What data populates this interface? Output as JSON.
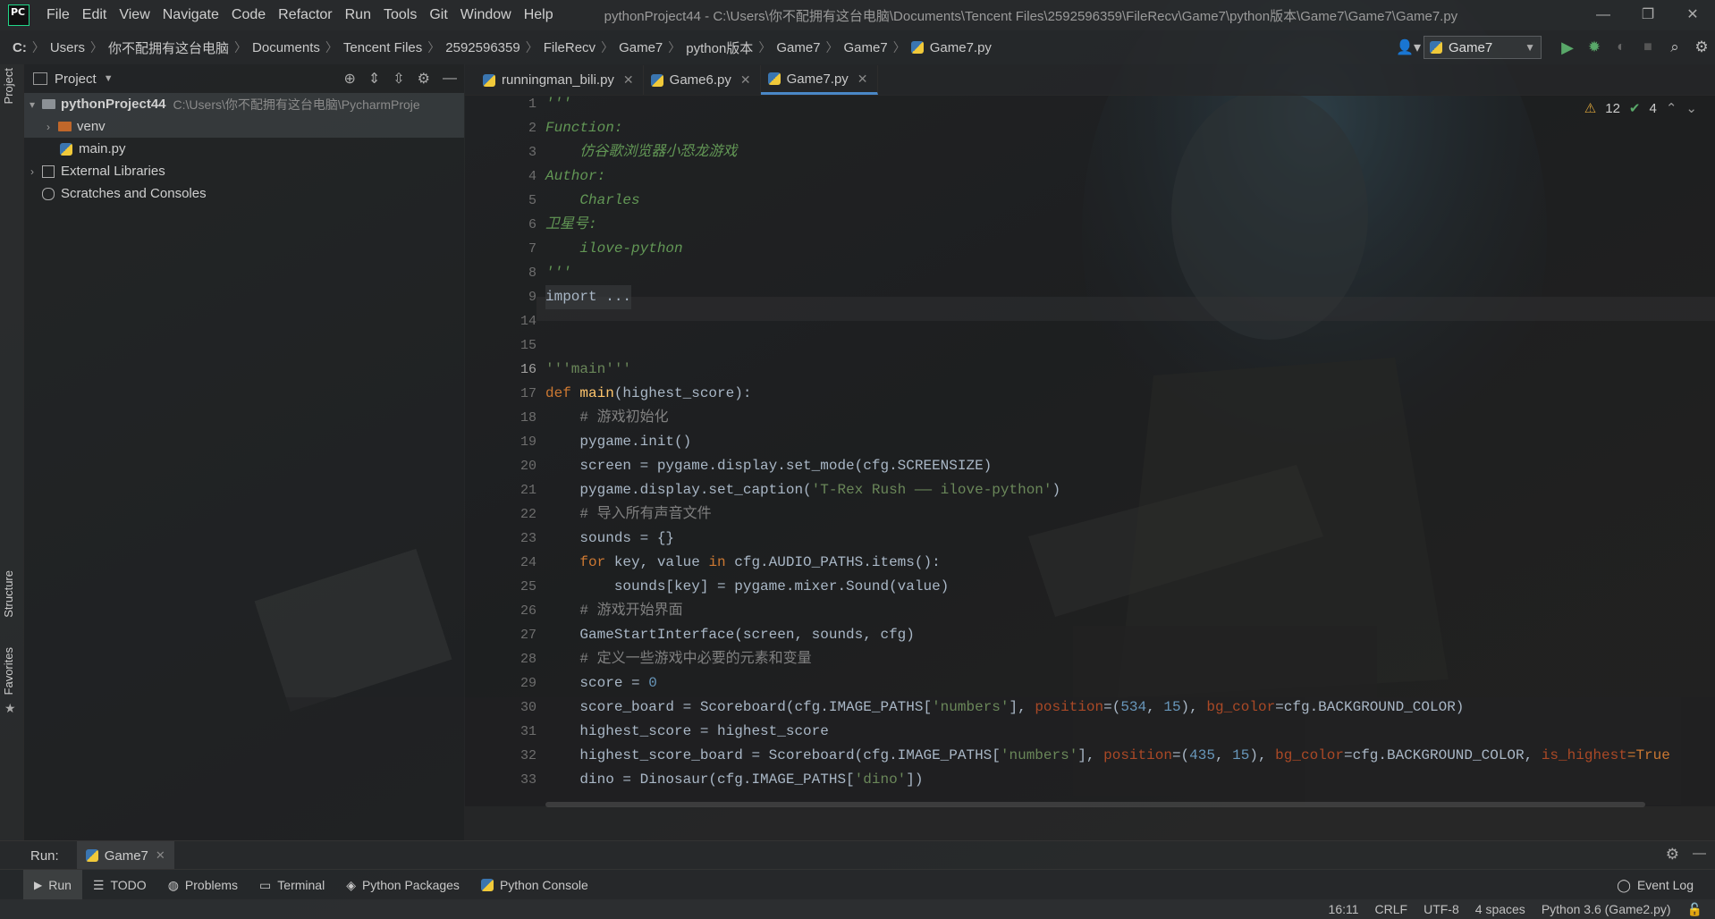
{
  "window": {
    "app_logo_text": "PC",
    "title": "pythonProject44 - C:\\Users\\你不配拥有这台电脑\\Documents\\Tencent Files\\2592596359\\FileRecv\\Game7\\python版本\\Game7\\Game7\\Game7.py",
    "controls": [
      "—",
      "❐",
      "✕"
    ]
  },
  "menu": [
    "File",
    "Edit",
    "View",
    "Navigate",
    "Code",
    "Refactor",
    "Run",
    "Tools",
    "Git",
    "Window",
    "Help"
  ],
  "breadcrumb": [
    "C:",
    "Users",
    "你不配拥有这台电脑",
    "Documents",
    "Tencent Files",
    "2592596359",
    "FileRecv",
    "Game7",
    "python版本",
    "Game7",
    "Game7",
    "Game7.py"
  ],
  "run_config": {
    "label": "Game7"
  },
  "left_tools": {
    "project": "Project",
    "structure": "Structure",
    "favorites": "Favorites"
  },
  "project_panel": {
    "title": "Project",
    "tree": [
      {
        "label": "pythonProject44",
        "path": "C:\\Users\\你不配拥有这台电脑\\PycharmProje",
        "type": "folder-root"
      },
      {
        "label": "venv",
        "type": "folder"
      },
      {
        "label": "main.py",
        "type": "file"
      },
      {
        "label": "External Libraries",
        "type": "library"
      },
      {
        "label": "Scratches and Consoles",
        "type": "scratch"
      }
    ]
  },
  "editor_tabs": [
    {
      "label": "runningman_bili.py"
    },
    {
      "label": "Game6.py"
    },
    {
      "label": "Game7.py"
    }
  ],
  "inspections": {
    "warnings": "12",
    "ok": "4"
  },
  "code": {
    "line_numbers": [
      "1",
      "2",
      "3",
      "4",
      "5",
      "6",
      "7",
      "8",
      "9",
      "14",
      "15",
      "16",
      "17",
      "18",
      "19",
      "20",
      "21",
      "22",
      "23",
      "24",
      "25",
      "26",
      "27",
      "28",
      "29",
      "30",
      "31",
      "32",
      "33"
    ],
    "l1": "'''",
    "l2": "Function:",
    "l3": "    仿谷歌浏览器小恐龙游戏",
    "l4": "Author:",
    "l5": "    Charles",
    "l6": "卫星号:",
    "l7": "    ilove-python",
    "l8": "'''",
    "l9": "import ...",
    "l16": "'''main'''",
    "l17_kw": "def ",
    "l17_fn": "main",
    "l17_rest": "(highest_score):",
    "l18": "    # 游戏初始化",
    "l19": "    pygame.init()",
    "l20": "    screen = pygame.display.set_mode(cfg.SCREENSIZE)",
    "l21_a": "    pygame.display.set_caption(",
    "l21_s": "'T-Rex Rush —— ilove-python'",
    "l21_b": ")",
    "l22": "    # 导入所有声音文件",
    "l23": "    sounds = {}",
    "l24_kw1": "    for",
    "l24_a": " key, value ",
    "l24_kw2": "in",
    "l24_b": " cfg.AUDIO_PATHS.items():",
    "l25": "        sounds[key] = pygame.mixer.Sound(value)",
    "l26": "    # 游戏开始界面",
    "l27": "    GameStartInterface(screen, sounds, cfg)",
    "l28": "    # 定义一些游戏中必要的元素和变量",
    "l29_a": "    score = ",
    "l29_n": "0",
    "l30_a": "    score_board = Scoreboard(cfg.IMAGE_PATHS[",
    "l30_s": "'numbers'",
    "l30_b": "], ",
    "l30_p1": "position",
    "l30_c": "=(",
    "l30_n1": "534",
    "l30_d": ", ",
    "l30_n2": "15",
    "l30_e": "), ",
    "l30_p2": "bg_color",
    "l30_f": "=cfg.BACKGROUND_COLOR)",
    "l31": "    highest_score = highest_score",
    "l32_a": "    highest_score_board = Scoreboard(cfg.IMAGE_PATHS[",
    "l32_s": "'numbers'",
    "l32_b": "], ",
    "l32_p1": "position",
    "l32_c": "=(",
    "l32_n1": "435",
    "l32_d": ", ",
    "l32_n2": "15",
    "l32_e": "), ",
    "l32_p2": "bg_color",
    "l32_f": "=cfg.BACKGROUND_COLOR, ",
    "l32_p3": "is_highest",
    "l32_g": "=True",
    "l33_a": "    dino = Dinosaur(cfg.IMAGE_PATHS[",
    "l33_s": "'dino'",
    "l33_b": "])"
  },
  "run_bar": {
    "label": "Run:",
    "tab": "Game7"
  },
  "bottom_tabs": [
    "Run",
    "TODO",
    "Problems",
    "Terminal",
    "Python Packages",
    "Python Console"
  ],
  "event_log": "Event Log",
  "status": {
    "position": "16:11",
    "line_sep": "CRLF",
    "encoding": "UTF-8",
    "indent": "4 spaces",
    "interpreter": "Python 3.6 (Game2.py)"
  },
  "colors": {
    "accent": "#4a88c7",
    "run_green": "#59a869",
    "keyword": "#cc7832",
    "string": "#6a8759",
    "docstring": "#629755"
  }
}
